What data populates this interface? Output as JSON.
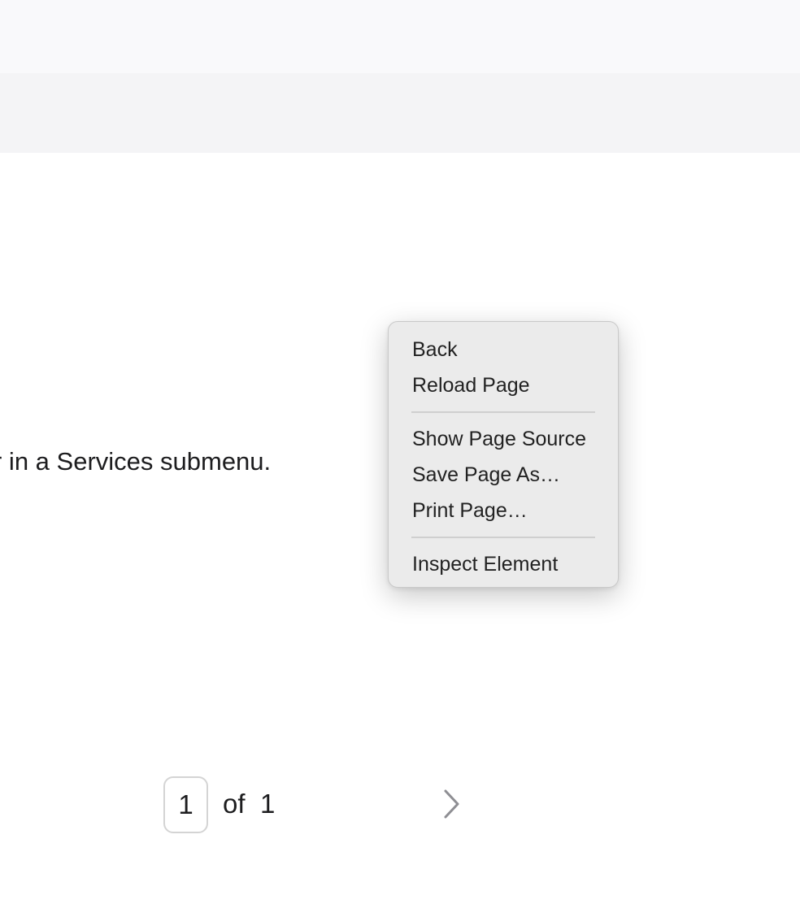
{
  "body": {
    "text": "r in a Services submenu."
  },
  "context_menu": {
    "groups": [
      [
        "Back",
        "Reload Page"
      ],
      [
        "Show Page Source",
        "Save Page As…",
        "Print Page…"
      ],
      [
        "Inspect Element"
      ]
    ]
  },
  "pagination": {
    "current_page": "1",
    "of_label": "of",
    "total_pages": "1",
    "next_icon": "chevron-right-icon"
  },
  "colors": {
    "top_bar": "#f9f9fb",
    "secondary_bar": "#f4f4f6",
    "menu_background": "#ebebeb",
    "chevron": "#8e8e93"
  }
}
